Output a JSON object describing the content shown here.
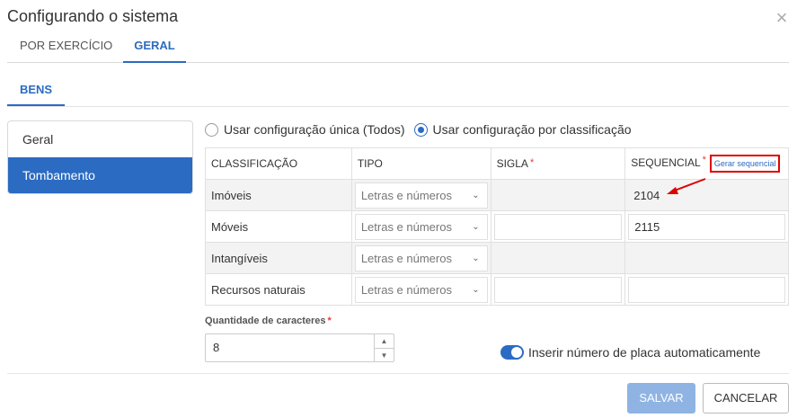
{
  "dialog": {
    "title": "Configurando o sistema",
    "close_icon": "close-icon"
  },
  "tabs": [
    {
      "label": "POR EXERCÍCIO",
      "active": false
    },
    {
      "label": "GERAL",
      "active": true
    }
  ],
  "subtab": {
    "label": "BENS"
  },
  "sidebar": {
    "items": [
      {
        "label": "Geral",
        "active": false
      },
      {
        "label": "Tombamento",
        "active": true
      }
    ]
  },
  "radios": [
    {
      "label": "Usar configuração única (Todos)",
      "checked": false
    },
    {
      "label": "Usar configuração por classificação",
      "checked": true
    }
  ],
  "table": {
    "headers": {
      "classificacao": "CLASSIFICAÇÃO",
      "tipo": "TIPO",
      "sigla": "SIGLA",
      "sequencial": "SEQUENCIAL",
      "required_mark": "*",
      "gerar_link": "Gerar sequencial"
    },
    "rows": [
      {
        "classificacao": "Imóveis",
        "tipo": "Letras e números",
        "sigla": "",
        "sequencial": "2104"
      },
      {
        "classificacao": "Móveis",
        "tipo": "Letras e números",
        "sigla": "",
        "sequencial": "2115"
      },
      {
        "classificacao": "Intangíveis",
        "tipo": "Letras e números",
        "sigla": "",
        "sequencial": ""
      },
      {
        "classificacao": "Recursos naturais",
        "tipo": "Letras e números",
        "sigla": "",
        "sequencial": ""
      }
    ]
  },
  "quantidade": {
    "label": "Quantidade de caracteres",
    "required_mark": "*",
    "value": "8"
  },
  "toggle": {
    "label": "Inserir número de placa automaticamente",
    "on": true
  },
  "buttons": {
    "save": "SALVAR",
    "cancel": "CANCELAR"
  },
  "colors": {
    "accent": "#2b6bc2",
    "annotation": "#e00000",
    "required": "#e53935"
  }
}
